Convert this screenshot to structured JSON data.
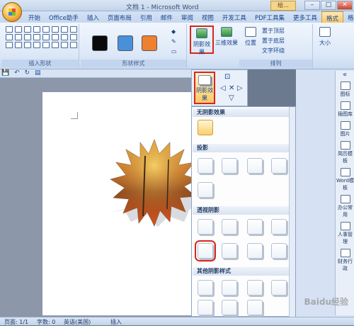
{
  "window": {
    "title": "文档 1 - Microsoft Word",
    "ext_label": "绘...",
    "buttons": [
      "–",
      "□",
      "✕"
    ]
  },
  "tabs": [
    "开始",
    "Office助手",
    "插入",
    "页面布局",
    "引用",
    "邮件",
    "审阅",
    "视图",
    "开发工具",
    "PDF工具集",
    "更多工具",
    "格式",
    "格式"
  ],
  "ribbon": {
    "insert_shapes_label": "插入形状",
    "shape_styles_label": "形状样式",
    "arrange_label": "排列",
    "shadow_effect_label": "阴影效果",
    "three_d_label": "三维效果",
    "position_label": "位置",
    "bring_front": "置于顶层",
    "send_back": "置于底层",
    "text_wrap": "文字环绕",
    "size_label": "大小",
    "swatch_colors": [
      "#0a0a0a",
      "#4a90d9",
      "#ef8030"
    ]
  },
  "shadow_dropdown": {
    "button_label": "阴影效果",
    "no_shadow": "无阴影效果",
    "drop_shadow": "投影",
    "perspective_shadow": "透视阴影",
    "other_styles": "其他阴影样式"
  },
  "taskpane": {
    "items": [
      "图标",
      "插图库",
      "图片",
      "简历模板",
      "Word模板",
      "办公常用",
      "人事管理",
      "财务行政"
    ]
  },
  "status": {
    "page": "页面: 1/1",
    "words": "字数: 0",
    "lang": "英语(美国)",
    "insert": "插入"
  },
  "watermark": "Baidu经验"
}
